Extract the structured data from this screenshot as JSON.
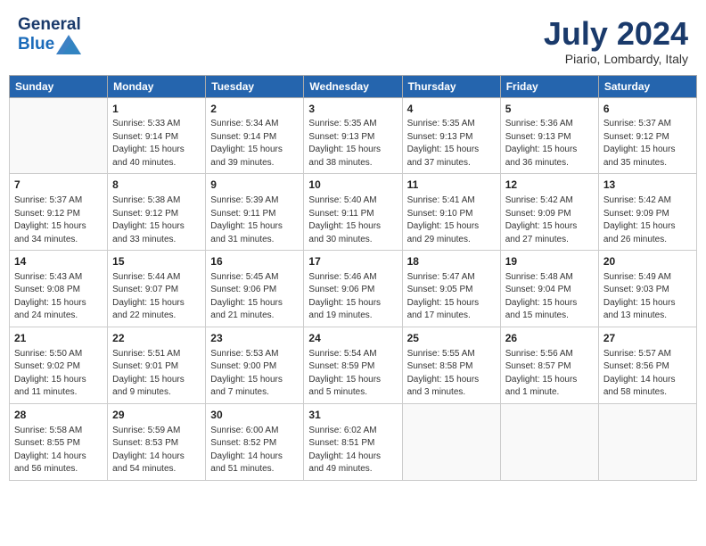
{
  "header": {
    "logo_general": "General",
    "logo_blue": "Blue",
    "month_title": "July 2024",
    "location": "Piario, Lombardy, Italy"
  },
  "weekdays": [
    "Sunday",
    "Monday",
    "Tuesday",
    "Wednesday",
    "Thursday",
    "Friday",
    "Saturday"
  ],
  "weeks": [
    [
      {
        "day": "",
        "info": ""
      },
      {
        "day": "1",
        "info": "Sunrise: 5:33 AM\nSunset: 9:14 PM\nDaylight: 15 hours\nand 40 minutes."
      },
      {
        "day": "2",
        "info": "Sunrise: 5:34 AM\nSunset: 9:14 PM\nDaylight: 15 hours\nand 39 minutes."
      },
      {
        "day": "3",
        "info": "Sunrise: 5:35 AM\nSunset: 9:13 PM\nDaylight: 15 hours\nand 38 minutes."
      },
      {
        "day": "4",
        "info": "Sunrise: 5:35 AM\nSunset: 9:13 PM\nDaylight: 15 hours\nand 37 minutes."
      },
      {
        "day": "5",
        "info": "Sunrise: 5:36 AM\nSunset: 9:13 PM\nDaylight: 15 hours\nand 36 minutes."
      },
      {
        "day": "6",
        "info": "Sunrise: 5:37 AM\nSunset: 9:12 PM\nDaylight: 15 hours\nand 35 minutes."
      }
    ],
    [
      {
        "day": "7",
        "info": "Sunrise: 5:37 AM\nSunset: 9:12 PM\nDaylight: 15 hours\nand 34 minutes."
      },
      {
        "day": "8",
        "info": "Sunrise: 5:38 AM\nSunset: 9:12 PM\nDaylight: 15 hours\nand 33 minutes."
      },
      {
        "day": "9",
        "info": "Sunrise: 5:39 AM\nSunset: 9:11 PM\nDaylight: 15 hours\nand 31 minutes."
      },
      {
        "day": "10",
        "info": "Sunrise: 5:40 AM\nSunset: 9:11 PM\nDaylight: 15 hours\nand 30 minutes."
      },
      {
        "day": "11",
        "info": "Sunrise: 5:41 AM\nSunset: 9:10 PM\nDaylight: 15 hours\nand 29 minutes."
      },
      {
        "day": "12",
        "info": "Sunrise: 5:42 AM\nSunset: 9:09 PM\nDaylight: 15 hours\nand 27 minutes."
      },
      {
        "day": "13",
        "info": "Sunrise: 5:42 AM\nSunset: 9:09 PM\nDaylight: 15 hours\nand 26 minutes."
      }
    ],
    [
      {
        "day": "14",
        "info": "Sunrise: 5:43 AM\nSunset: 9:08 PM\nDaylight: 15 hours\nand 24 minutes."
      },
      {
        "day": "15",
        "info": "Sunrise: 5:44 AM\nSunset: 9:07 PM\nDaylight: 15 hours\nand 22 minutes."
      },
      {
        "day": "16",
        "info": "Sunrise: 5:45 AM\nSunset: 9:06 PM\nDaylight: 15 hours\nand 21 minutes."
      },
      {
        "day": "17",
        "info": "Sunrise: 5:46 AM\nSunset: 9:06 PM\nDaylight: 15 hours\nand 19 minutes."
      },
      {
        "day": "18",
        "info": "Sunrise: 5:47 AM\nSunset: 9:05 PM\nDaylight: 15 hours\nand 17 minutes."
      },
      {
        "day": "19",
        "info": "Sunrise: 5:48 AM\nSunset: 9:04 PM\nDaylight: 15 hours\nand 15 minutes."
      },
      {
        "day": "20",
        "info": "Sunrise: 5:49 AM\nSunset: 9:03 PM\nDaylight: 15 hours\nand 13 minutes."
      }
    ],
    [
      {
        "day": "21",
        "info": "Sunrise: 5:50 AM\nSunset: 9:02 PM\nDaylight: 15 hours\nand 11 minutes."
      },
      {
        "day": "22",
        "info": "Sunrise: 5:51 AM\nSunset: 9:01 PM\nDaylight: 15 hours\nand 9 minutes."
      },
      {
        "day": "23",
        "info": "Sunrise: 5:53 AM\nSunset: 9:00 PM\nDaylight: 15 hours\nand 7 minutes."
      },
      {
        "day": "24",
        "info": "Sunrise: 5:54 AM\nSunset: 8:59 PM\nDaylight: 15 hours\nand 5 minutes."
      },
      {
        "day": "25",
        "info": "Sunrise: 5:55 AM\nSunset: 8:58 PM\nDaylight: 15 hours\nand 3 minutes."
      },
      {
        "day": "26",
        "info": "Sunrise: 5:56 AM\nSunset: 8:57 PM\nDaylight: 15 hours\nand 1 minute."
      },
      {
        "day": "27",
        "info": "Sunrise: 5:57 AM\nSunset: 8:56 PM\nDaylight: 14 hours\nand 58 minutes."
      }
    ],
    [
      {
        "day": "28",
        "info": "Sunrise: 5:58 AM\nSunset: 8:55 PM\nDaylight: 14 hours\nand 56 minutes."
      },
      {
        "day": "29",
        "info": "Sunrise: 5:59 AM\nSunset: 8:53 PM\nDaylight: 14 hours\nand 54 minutes."
      },
      {
        "day": "30",
        "info": "Sunrise: 6:00 AM\nSunset: 8:52 PM\nDaylight: 14 hours\nand 51 minutes."
      },
      {
        "day": "31",
        "info": "Sunrise: 6:02 AM\nSunset: 8:51 PM\nDaylight: 14 hours\nand 49 minutes."
      },
      {
        "day": "",
        "info": ""
      },
      {
        "day": "",
        "info": ""
      },
      {
        "day": "",
        "info": ""
      }
    ]
  ]
}
